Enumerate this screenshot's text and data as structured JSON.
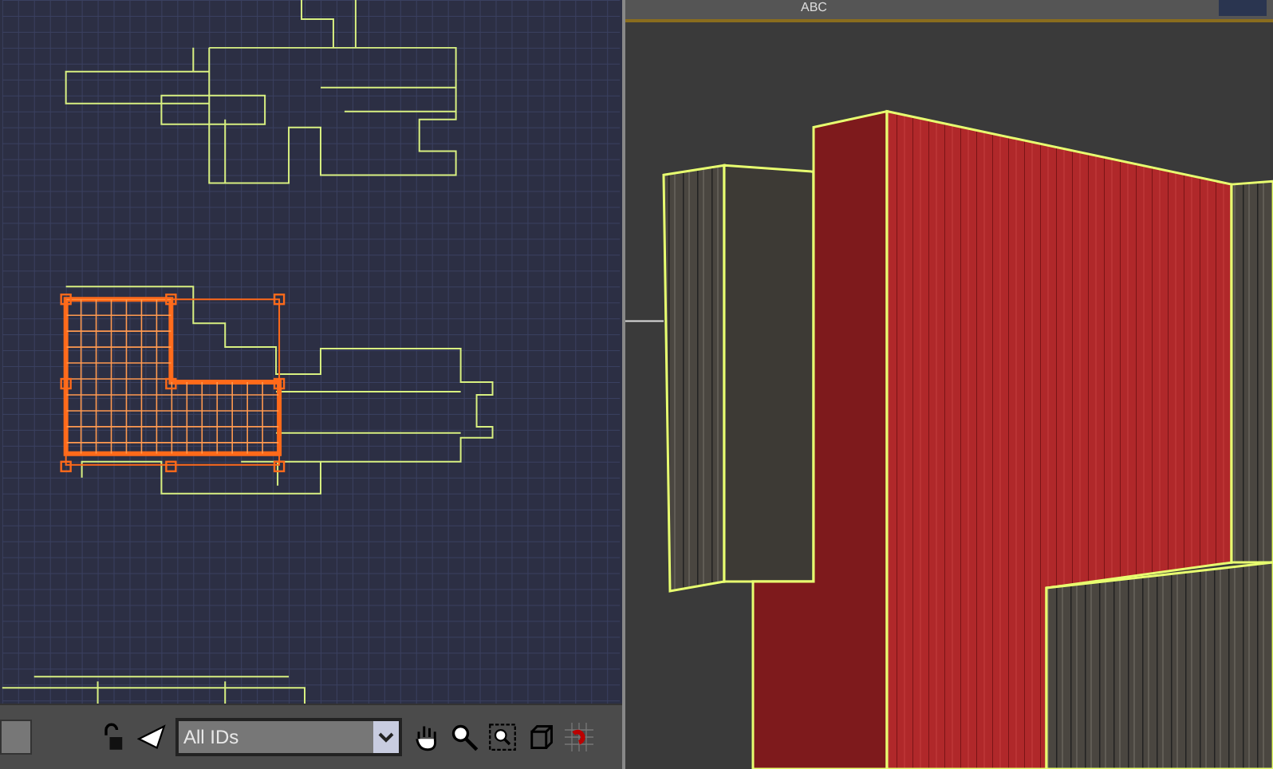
{
  "uv_editor": {
    "toolbar": {
      "id_filter": {
        "value": "All IDs"
      }
    }
  },
  "viewport": {
    "toolbar": {
      "label": "ABC"
    }
  }
}
